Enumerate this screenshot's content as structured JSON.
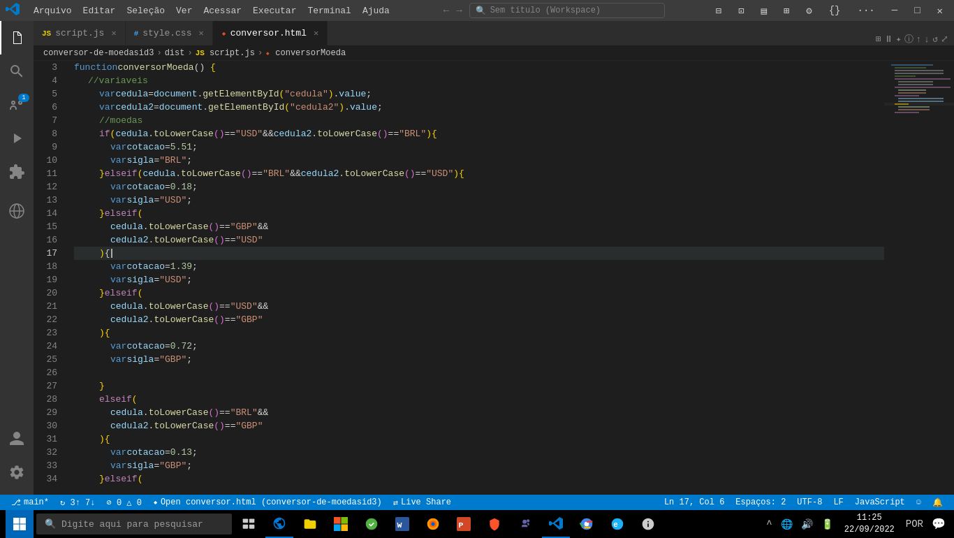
{
  "titlebar": {
    "logo": "VS",
    "menu": [
      "Arquivo",
      "Editar",
      "Seleção",
      "Ver",
      "Acessar",
      "Executar",
      "Terminal",
      "Ajuda"
    ],
    "search_text": "Sem título (Workspace)",
    "nav_back": "←",
    "nav_forward": "→"
  },
  "tabs": [
    {
      "id": "script-js",
      "label": "script.js",
      "type": "js",
      "active": false,
      "modified": false
    },
    {
      "id": "style-css",
      "label": "style.css",
      "type": "css",
      "active": false,
      "modified": false
    },
    {
      "id": "conversor-html",
      "label": "conversor.html",
      "type": "html",
      "active": true,
      "modified": true
    }
  ],
  "breadcrumb": [
    "conversor-de-moedasid3",
    "dist",
    "JS script.js",
    "conversorMoeda"
  ],
  "lines": [
    {
      "num": 3,
      "content": "function conversorMoeda() {"
    },
    {
      "num": 4,
      "content": "  //variaveis"
    },
    {
      "num": 5,
      "content": "    var cedula = document.getElementById(\"cedula\").value;"
    },
    {
      "num": 6,
      "content": "    var cedula2 = document.getElementById(\"cedula2\").value;"
    },
    {
      "num": 7,
      "content": "    //moedas"
    },
    {
      "num": 8,
      "content": "    if (cedula.toLowerCase() == \"USD\" && cedula2.toLowerCase() == \"BRL\") {"
    },
    {
      "num": 9,
      "content": "      var cotacao = 5.51;"
    },
    {
      "num": 10,
      "content": "      var sigla = \"BRL\";"
    },
    {
      "num": 11,
      "content": "    } else if (cedula.toLowerCase() == \"BRL\" && cedula2.toLowerCase() == \"USD\") {"
    },
    {
      "num": 12,
      "content": "      var cotacao = 0.18;"
    },
    {
      "num": 13,
      "content": "      var sigla = \"USD\";"
    },
    {
      "num": 14,
      "content": "    } else if ("
    },
    {
      "num": 15,
      "content": "      cedula.toLowerCase() == \"GBP\" &&"
    },
    {
      "num": 16,
      "content": "      cedula2.toLowerCase() == \"USD\""
    },
    {
      "num": 17,
      "content": "    ) {",
      "current": true
    },
    {
      "num": 18,
      "content": "      var cotacao = 1.39;"
    },
    {
      "num": 19,
      "content": "      var sigla = \"USD\";"
    },
    {
      "num": 20,
      "content": "    } else if ("
    },
    {
      "num": 21,
      "content": "      cedula.toLowerCase() == \"USD\" &&"
    },
    {
      "num": 22,
      "content": "      cedula2.toLowerCase() == \"GBP\""
    },
    {
      "num": 23,
      "content": "    ) {"
    },
    {
      "num": 24,
      "content": "      var cotacao = 0.72;"
    },
    {
      "num": 25,
      "content": "      var sigla = \"GBP\";"
    },
    {
      "num": 26,
      "content": ""
    },
    {
      "num": 27,
      "content": "    }"
    },
    {
      "num": 28,
      "content": "    else if ("
    },
    {
      "num": 29,
      "content": "      cedula.toLowerCase() == \"BRL\" &&"
    },
    {
      "num": 30,
      "content": "      cedula2.toLowerCase() == \"GBP\""
    },
    {
      "num": 31,
      "content": "    ) {"
    },
    {
      "num": 32,
      "content": "      var cotacao = 0.13;"
    },
    {
      "num": 33,
      "content": "      var sigla = \"GBP\";"
    },
    {
      "num": 34,
      "content": "    }else if ("
    }
  ],
  "statusbar": {
    "branch": "main*",
    "sync": "↻ 3↑ 7↓",
    "errors": "⊘ 0 △ 0",
    "live_share": "Live Share",
    "position": "Ln 17, Col 6",
    "spaces": "Espaços: 2",
    "encoding": "UTF-8",
    "line_ending": "LF",
    "language": "JavaScript",
    "feedback": "☺",
    "bell": "🔔"
  },
  "taskbar": {
    "search_placeholder": "Digite aqui para pesquisar",
    "clock_time": "11:25",
    "clock_date": "22/09/2022",
    "language": "POR"
  },
  "activity": {
    "explorer": "📁",
    "search": "🔍",
    "git": "⎇",
    "debug": "▷",
    "extensions": "⊞",
    "remote": "🌐",
    "account": "👤",
    "settings": "⚙"
  }
}
